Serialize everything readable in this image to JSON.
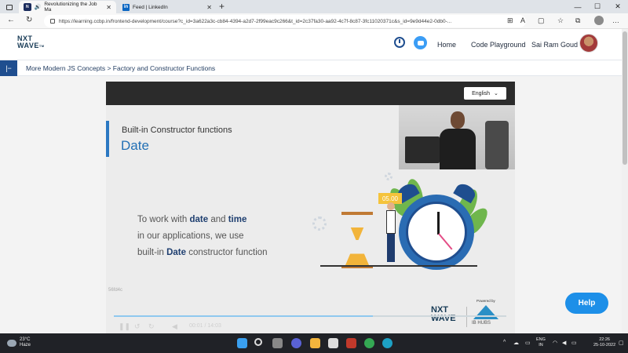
{
  "browser": {
    "tabs": [
      {
        "title": "Revolutionizing the Job Ma",
        "active": true
      },
      {
        "title": "Feed | LinkedIn",
        "active": false
      }
    ],
    "url": "https://learning.ccbp.in/frontend-development/course?c_id=3a622a3c-cb84-4394-a2d7-2f99eac9c266&t_id=2c37fa30-aa92-4c7f-8c87-3fc11020371c&s_id=9e9d44e2-0db0-..."
  },
  "header": {
    "logo_line1": "NXT",
    "logo_line2": "WAVE",
    "logo_tm": "TM",
    "home": "Home",
    "code_playground": "Code Playground",
    "user_name": "Sai Ram Goud"
  },
  "breadcrumb": "More Modern JS Concepts > Factory and Constructor Functions",
  "video": {
    "language": "English",
    "subtitle": "Built-in Constructor functions",
    "title": "Date",
    "body_line1_a": "To work with ",
    "body_line1_b": "date",
    "body_line1_c": " and ",
    "body_line1_d": "time",
    "body_line2": "in our applications, we use",
    "body_line3_a": "built-in ",
    "body_line3_b": "Date",
    "body_line3_c": " constructor function",
    "sign_text": "05.00",
    "watermark": "56fd4c",
    "time": "00:01 / 14:03",
    "progress": 0.66,
    "brand_line1": "NXT",
    "brand_line2": "WAVE",
    "powered_by": "Powered by",
    "ib_hubs": "IB HUBS"
  },
  "help_label": "Help",
  "taskbar": {
    "temp": "23°C",
    "weather": "Haze",
    "lang_line1": "ENG",
    "lang_line2": "IN",
    "clock_time": "22:26",
    "clock_date": "25-10-2022"
  },
  "colors": {
    "accent": "#2270b5",
    "help": "#1d8fe8",
    "brand_navy": "#183b56"
  }
}
